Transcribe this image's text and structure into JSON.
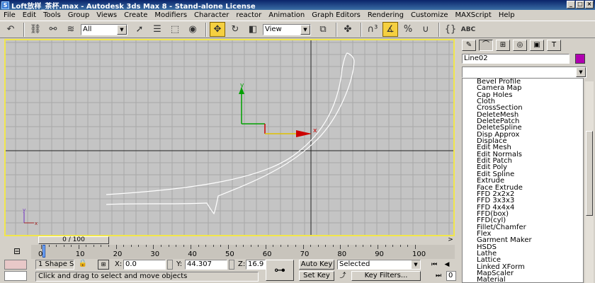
{
  "window": {
    "title": "Loft放样_茶杯.max - Autodesk 3ds Max 8 - Stand-alone License",
    "minimize": "_",
    "maximize": "□",
    "close": "×"
  },
  "menu": [
    "File",
    "Edit",
    "Tools",
    "Group",
    "Views",
    "Create",
    "Modifiers",
    "Character",
    "reactor",
    "Animation",
    "Graph Editors",
    "Rendering",
    "Customize",
    "MAXScript",
    "Help"
  ],
  "toolbar": {
    "selection_filter": "All",
    "coord_system": "View",
    "render_label": "ABC"
  },
  "viewport": {
    "axis_x": "x",
    "axis_y": "y",
    "colors": {
      "border": "#f1e64a",
      "grid": "#a8a8a8",
      "curve": "#ffffff"
    }
  },
  "command_panel": {
    "object_name": "Line02",
    "object_color": "#b000b0",
    "modifiers": [
      "Bevel Profile",
      "Camera Map",
      "Cap Holes",
      "Cloth",
      "CrossSection",
      "DeleteMesh",
      "DeletePatch",
      "DeleteSpline",
      "Disp Approx",
      "Displace",
      "Edit Mesh",
      "Edit Normals",
      "Edit Patch",
      "Edit Poly",
      "Edit Spline",
      "Extrude",
      "Face Extrude",
      "FFD 2x2x2",
      "FFD 3x3x3",
      "FFD 4x4x4",
      "FFD(box)",
      "FFD(cyl)",
      "Fillet/Chamfer",
      "Flex",
      "Garment Maker",
      "HSDS",
      "Lathe",
      "Lattice",
      "Linked XForm",
      "MapScaler",
      "Material"
    ]
  },
  "timeline": {
    "slider_label": "0 / 100",
    "ticks": [
      "0",
      "10",
      "20",
      "30",
      "40",
      "50",
      "60",
      "70",
      "80",
      "90",
      "100"
    ]
  },
  "status": {
    "selection": "1 Shape S",
    "x_label": "X:",
    "x_value": "0.0",
    "y_label": "Y:",
    "y_value": "44.307",
    "z_label": "Z:",
    "z_value": "16.9",
    "prompt": "Click and drag to select and move objects",
    "auto_key": "Auto Key",
    "set_key": "Set Key",
    "selected": "Selected",
    "key_filters": "Key Filters...",
    "current_frame": "0"
  }
}
